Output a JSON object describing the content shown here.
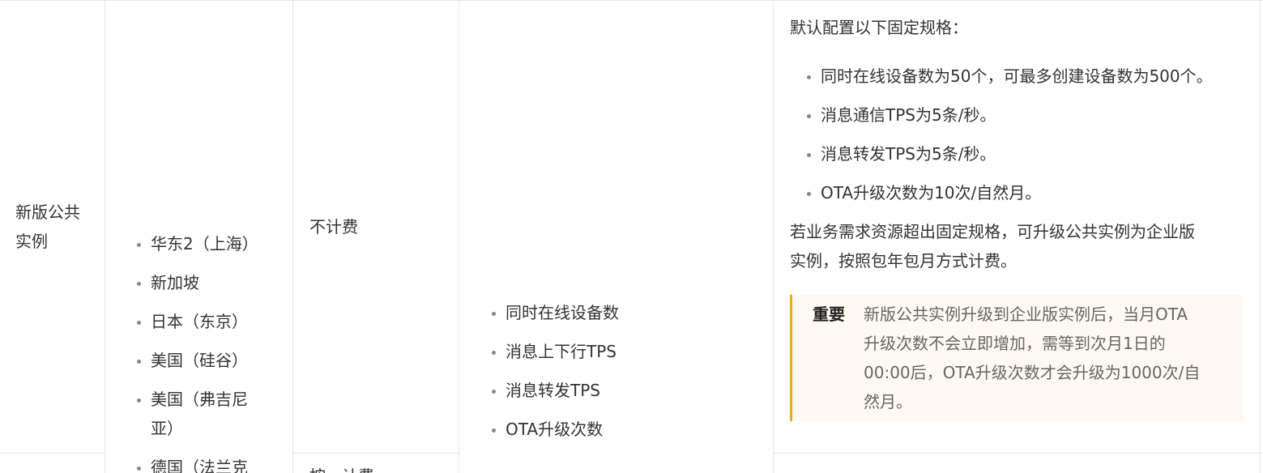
{
  "row1": {
    "col1": {
      "line1": "新版公共",
      "line2": "实例"
    },
    "regions": [
      "华东2（上海）",
      "新加坡",
      "日本（东京）",
      "美国（硅谷）",
      "美国（弗吉尼亚）",
      "德国（法兰克"
    ],
    "billing": "不计费",
    "metrics": [
      "同时在线设备数",
      "消息上下行TPS",
      "消息转发TPS",
      "OTA升级次数"
    ],
    "spec": {
      "intro": "默认配置以下固定规格：",
      "items": [
        "同时在线设备数为50个，可最多创建设备数为500个。",
        "消息通信TPS为5条/秒。",
        "消息转发TPS为5条/秒。",
        "OTA升级次数为10次/自然月。"
      ],
      "upgrade_line1": "若业务需求资源超出固定规格，可升级公共实例为企业版",
      "upgrade_line2": "实例，按照包年包月方式计费。",
      "note_title": "重要",
      "note_lines": [
        "新版公共实例升级到企业版实例后，当月OTA",
        "升级次数不会立即增加，需等到次月1日的",
        "00:00后，OTA升级次数才会升级为1000次/自",
        "然月。"
      ]
    }
  },
  "row2": {
    "billing_partial": "按…计费"
  }
}
